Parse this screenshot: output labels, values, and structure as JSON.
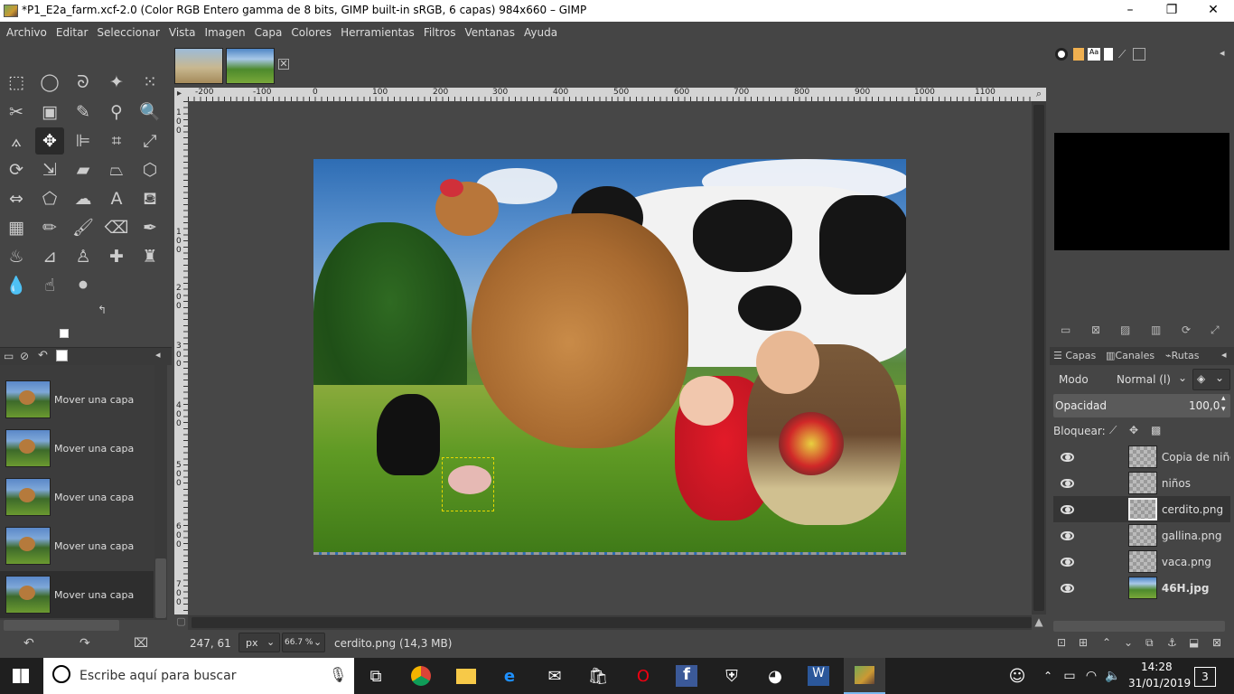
{
  "window": {
    "title": "*P1_E2a_farm.xcf-2.0 (Color RGB Entero gamma de 8 bits, GIMP built-in sRGB, 6 capas) 984x660 – GIMP"
  },
  "menubar": [
    "Archivo",
    "Editar",
    "Seleccionar",
    "Vista",
    "Imagen",
    "Capa",
    "Colores",
    "Herramientas",
    "Filtros",
    "Ventanas",
    "Ayuda"
  ],
  "colors": {
    "foreground": "#8b6756",
    "background": "#5a4e44"
  },
  "undo_history": {
    "items": [
      "Mover una capa",
      "Mover una capa",
      "Mover una capa",
      "Mover una capa",
      "Mover una capa"
    ]
  },
  "ruler": {
    "top_ticks": [
      "-200",
      "-100",
      "0",
      "100",
      "200",
      "300",
      "400",
      "500",
      "600",
      "700",
      "800",
      "900",
      "1000",
      "1100"
    ],
    "left_ticks": [
      "1",
      "0",
      "0",
      "1",
      "0",
      "0",
      "2",
      "0",
      "0",
      "3",
      "0",
      "0",
      "4",
      "0",
      "0",
      "5",
      "0",
      "0",
      "6",
      "0",
      "0",
      "7",
      "0",
      "0"
    ]
  },
  "status": {
    "coords": "247, 61",
    "unit": "px",
    "zoom": "66.7 %",
    "info": "cerdito.png (14,3 MB)"
  },
  "layers_panel": {
    "tabs": [
      "Capas",
      "Canales",
      "Rutas"
    ],
    "mode_label": "Modo",
    "mode_value": "Normal (l)",
    "opacity_label": "Opacidad",
    "opacity_value": "100,0",
    "lock_label": "Bloquear:",
    "layers": [
      {
        "name": "Copia de niños",
        "bold": false
      },
      {
        "name": "niños",
        "bold": false
      },
      {
        "name": "cerdito.png",
        "bold": false,
        "selected": true
      },
      {
        "name": "gallina.png",
        "bold": false
      },
      {
        "name": "vaca.png",
        "bold": false
      },
      {
        "name": "46H.jpg",
        "bold": true
      }
    ]
  },
  "taskbar": {
    "search_placeholder": "Escribe aquí para buscar",
    "time": "14:28",
    "date": "31/01/2019",
    "notifications": "3"
  }
}
